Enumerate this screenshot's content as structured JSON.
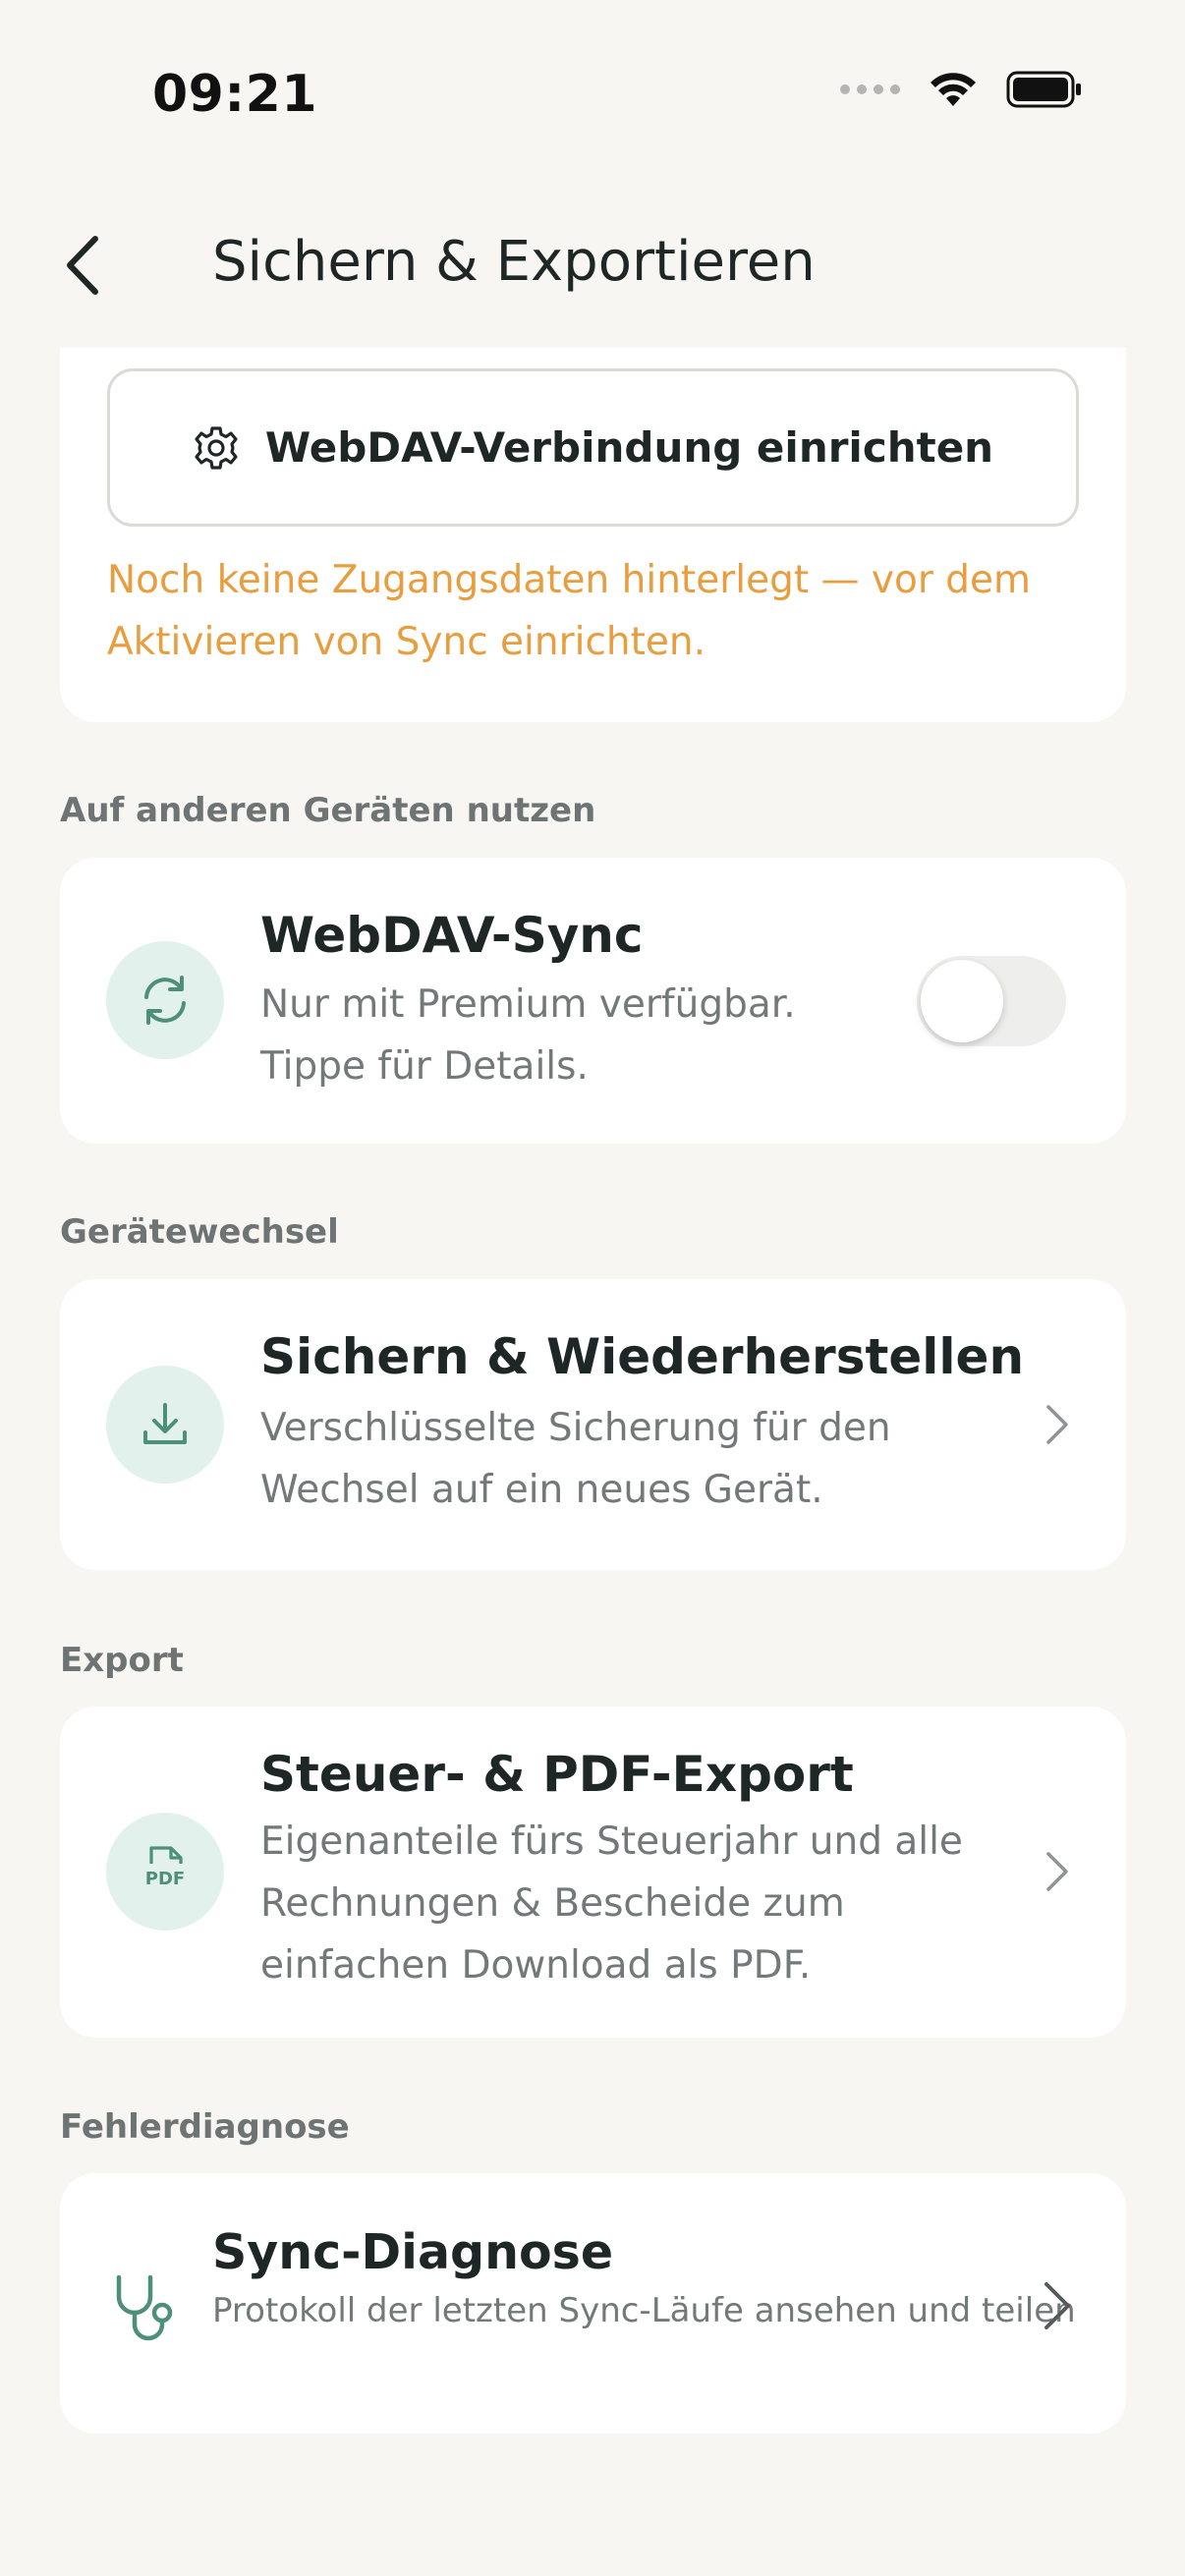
{
  "status_bar": {
    "time": "09:21"
  },
  "header": {
    "title": "Sichern & Exportieren"
  },
  "webdav_setup": {
    "button_label": "WebDAV-Verbindung einrichten",
    "warning": "Noch keine Zugangsdaten hinterlegt — vor dem Aktivieren von Sync einrichten."
  },
  "sections": {
    "other_devices": "Auf anderen Geräten nutzen",
    "device_change": "Gerätewechsel",
    "export": "Export",
    "diagnostics": "Fehlerdiagnose"
  },
  "sync": {
    "title": "WebDAV-Sync",
    "subtitle": "Nur mit Premium verfügbar. Tippe für Details.",
    "toggle_on": false
  },
  "backup": {
    "title": "Sichern & Wiederherstellen",
    "subtitle": "Verschlüsselte Sicherung für den Wechsel auf ein neues Gerät."
  },
  "tax_export": {
    "title": "Steuer- & PDF-Export",
    "subtitle": "Eigenanteile fürs Steuerjahr und alle Rechnungen & Bescheide zum einfachen Download als PDF.",
    "icon_text": "PDF"
  },
  "diagnosis": {
    "title": "Sync-Diagnose",
    "subtitle": "Protokoll der letzten Sync-Läufe ansehen und teilen"
  },
  "colors": {
    "background": "#f8f6f2",
    "card": "#ffffff",
    "accent": "#4d8f78",
    "icon_bg": "#e3f1ec",
    "warning": "#e89d3f"
  }
}
